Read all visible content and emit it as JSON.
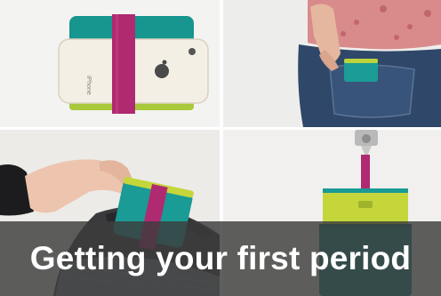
{
  "caption": {
    "text": "Getting your first period"
  },
  "panels": [
    {
      "subject": "teal pouch strapped to white phone with magenta band",
      "phone_label": "iPhone"
    },
    {
      "subject": "pouch tucked into back jeans pocket"
    },
    {
      "subject": "hand placing pouch into a bag"
    },
    {
      "subject": "lime and teal pouch hanging from a hook"
    }
  ],
  "colors": {
    "teal": "#1a9e9a",
    "lime": "#c4d63a",
    "magenta": "#b3266f",
    "caption_bg": "#3c3c3c",
    "caption_text": "#ffffff"
  }
}
